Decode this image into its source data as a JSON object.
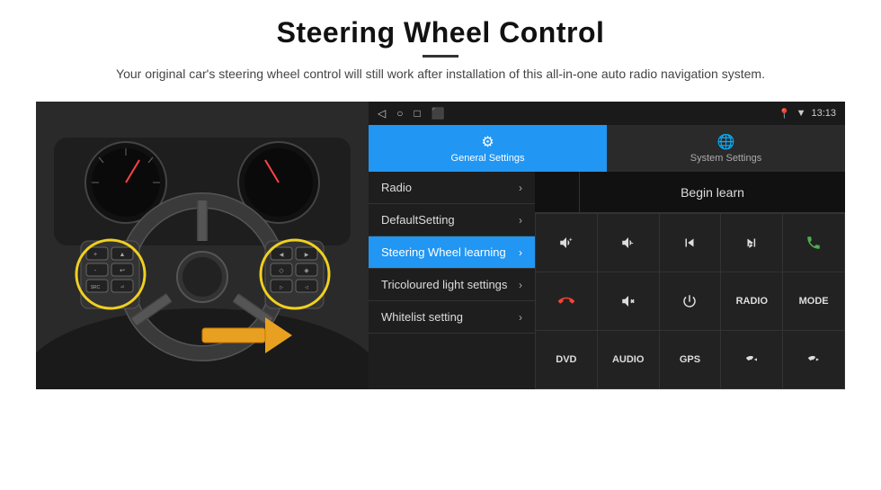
{
  "header": {
    "title": "Steering Wheel Control",
    "subtitle": "Your original car's steering wheel control will still work after installation of this all-in-one auto radio navigation system."
  },
  "statusBar": {
    "navIcons": [
      "◁",
      "○",
      "□",
      "⬛"
    ],
    "rightInfo": "13:13",
    "icons": [
      "📍",
      "▼"
    ]
  },
  "tabs": [
    {
      "id": "general",
      "label": "General Settings",
      "icon": "⚙",
      "active": true
    },
    {
      "id": "system",
      "label": "System Settings",
      "icon": "🌐",
      "active": false
    }
  ],
  "menuItems": [
    {
      "id": "radio",
      "label": "Radio",
      "active": false
    },
    {
      "id": "default-setting",
      "label": "DefaultSetting",
      "active": false
    },
    {
      "id": "steering-wheel",
      "label": "Steering Wheel learning",
      "active": true
    },
    {
      "id": "tricoloured",
      "label": "Tricoloured light settings",
      "active": false
    },
    {
      "id": "whitelist",
      "label": "Whitelist setting",
      "active": false
    }
  ],
  "beginLearn": {
    "label": "Begin learn"
  },
  "gridButtons": [
    {
      "id": "vol-up",
      "type": "icon",
      "symbol": "🔊+",
      "label": "Volume Up"
    },
    {
      "id": "vol-down",
      "type": "icon",
      "symbol": "🔉-",
      "label": "Volume Down"
    },
    {
      "id": "prev-track",
      "type": "icon",
      "symbol": "⏮",
      "label": "Previous Track"
    },
    {
      "id": "next-track",
      "type": "icon",
      "symbol": "⏭",
      "label": "Next Track"
    },
    {
      "id": "phone",
      "type": "icon",
      "symbol": "📞",
      "label": "Phone"
    },
    {
      "id": "hang-up",
      "type": "icon",
      "symbol": "📵",
      "label": "Hang Up"
    },
    {
      "id": "mute",
      "type": "icon",
      "symbol": "🔇",
      "label": "Mute"
    },
    {
      "id": "power",
      "type": "icon",
      "symbol": "⏻",
      "label": "Power"
    },
    {
      "id": "radio-btn",
      "type": "text",
      "symbol": "RADIO",
      "label": "Radio"
    },
    {
      "id": "mode",
      "type": "text",
      "symbol": "MODE",
      "label": "Mode"
    },
    {
      "id": "dvd",
      "type": "text",
      "symbol": "DVD",
      "label": "DVD"
    },
    {
      "id": "audio",
      "type": "text",
      "symbol": "AUDIO",
      "label": "Audio"
    },
    {
      "id": "gps",
      "type": "text",
      "symbol": "GPS",
      "label": "GPS"
    },
    {
      "id": "tel-prev",
      "type": "icon",
      "symbol": "📞⏮",
      "label": "Tel Prev"
    },
    {
      "id": "tel-next",
      "type": "icon",
      "symbol": "📞⏭",
      "label": "Tel Next"
    }
  ]
}
